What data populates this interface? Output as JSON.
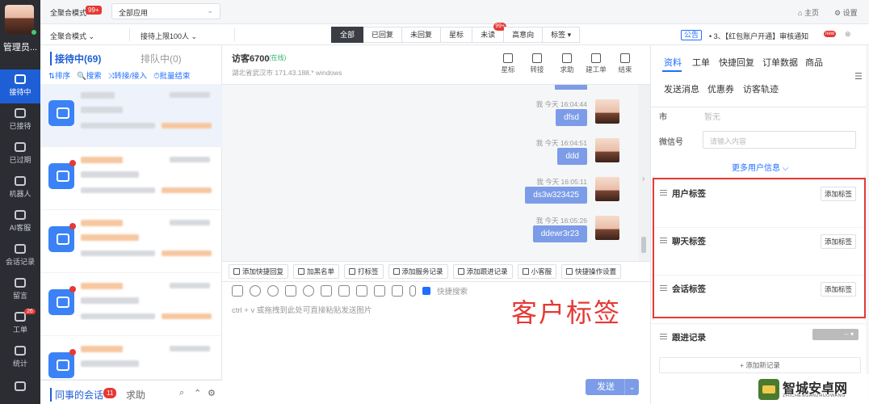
{
  "agent": {
    "name": "管理员..."
  },
  "nav": [
    {
      "label": "接待中",
      "active": true,
      "icon": "chat-bubble-icon"
    },
    {
      "label": "已接待",
      "icon": "chat-check-icon"
    },
    {
      "label": "已过期",
      "icon": "expired-icon"
    },
    {
      "label": "机器人",
      "icon": "robot-icon"
    },
    {
      "label": "AI客服",
      "icon": "ai-icon"
    },
    {
      "label": "会话记录",
      "icon": "record-icon"
    },
    {
      "label": "留言",
      "icon": "message-icon"
    },
    {
      "label": "工单",
      "icon": "ticket-icon",
      "badge": "26"
    },
    {
      "label": "统计",
      "icon": "stats-icon"
    }
  ],
  "topbar": {
    "mode_label": "全聚合模式",
    "mode_badge": "99+",
    "app_select": "全部应用",
    "home": "主页",
    "settings": "设置"
  },
  "bar2": {
    "mode_select": "全聚合模式",
    "limit_select": "接待上限100人",
    "filters": [
      {
        "label": "全部",
        "active": true
      },
      {
        "label": "已回复"
      },
      {
        "label": "未回复"
      },
      {
        "label": "星标"
      },
      {
        "label": "未读",
        "badge": "99+"
      },
      {
        "label": "高意向"
      },
      {
        "label": "标签 ▾"
      }
    ],
    "notice_tag": "公告",
    "notice_text": "• 3、【红包账户开通】审核通知",
    "notice_new": "new"
  },
  "sessions": {
    "tab_serving": "接待中(69)",
    "tab_queue": "排队中(0)",
    "tools": [
      "⇅排序",
      "🔍搜索",
      "⤨转接/接入",
      "⏱批量结束"
    ],
    "colleague_label": "同事的会话",
    "colleague_badge": "11",
    "help_tab": "求助"
  },
  "chat": {
    "visitor_name": "访客6700",
    "online": "(在线)",
    "visitor_info": "湖北省武汉市    171.43.188.*      windows",
    "tools": [
      {
        "label": "星标",
        "icon": "star-icon"
      },
      {
        "label": "转接",
        "icon": "transfer-icon"
      },
      {
        "label": "求助",
        "icon": "help-icon"
      },
      {
        "label": "建工单",
        "icon": "create-ticket-icon"
      },
      {
        "label": "结束",
        "icon": "power-icon"
      }
    ],
    "messages": [
      {
        "meta": "我  今天 16:04:44",
        "text": "dfsd"
      },
      {
        "meta": "我  今天 16:04:51",
        "text": "ddd"
      },
      {
        "meta": "我  今天 16:05:11",
        "text": "ds3w323425"
      },
      {
        "meta": "我  今天 16:05:26",
        "text": "ddewr3r23"
      }
    ],
    "quick_actions": [
      "添加快捷回复",
      "加黑名单",
      "打标签",
      "添加服务记录",
      "添加跟进记录",
      "小客服",
      "快捷操作设置"
    ],
    "quick_search": "快捷搜索",
    "input_placeholder": "ctrl + v 或拖拽到此处可直接粘贴发送图片",
    "annotation": "客户标签",
    "send": "发送"
  },
  "right": {
    "tabs_row1": [
      "资料",
      "工单",
      "快捷回复",
      "订单数据",
      "商品"
    ],
    "tabs_row2": [
      "发送消息",
      "优惠券",
      "访客轨迹"
    ],
    "city_label": "市",
    "city_value": "暂无",
    "wechat_label": "微信号",
    "wechat_placeholder": "请输入内容",
    "more_info": "更多用户信息 ⌵",
    "tag_sections": [
      {
        "title": "用户标签",
        "button": "添加标签"
      },
      {
        "title": "聊天标签",
        "button": "添加标签"
      },
      {
        "title": "会话标签",
        "button": "添加标签"
      }
    ],
    "follow_label": "跟进记录",
    "follow_select": "-- ▾",
    "add_record": "+ 添加新记录"
  },
  "watermark": {
    "title": "智城安卓网",
    "sub": "ZHICHENGANZHUOWANG"
  },
  "colors": {
    "accent": "#1f6fff",
    "nav_bg": "#2b2d33",
    "bubble": "#7c9ce8",
    "annotation": "#e53935"
  }
}
